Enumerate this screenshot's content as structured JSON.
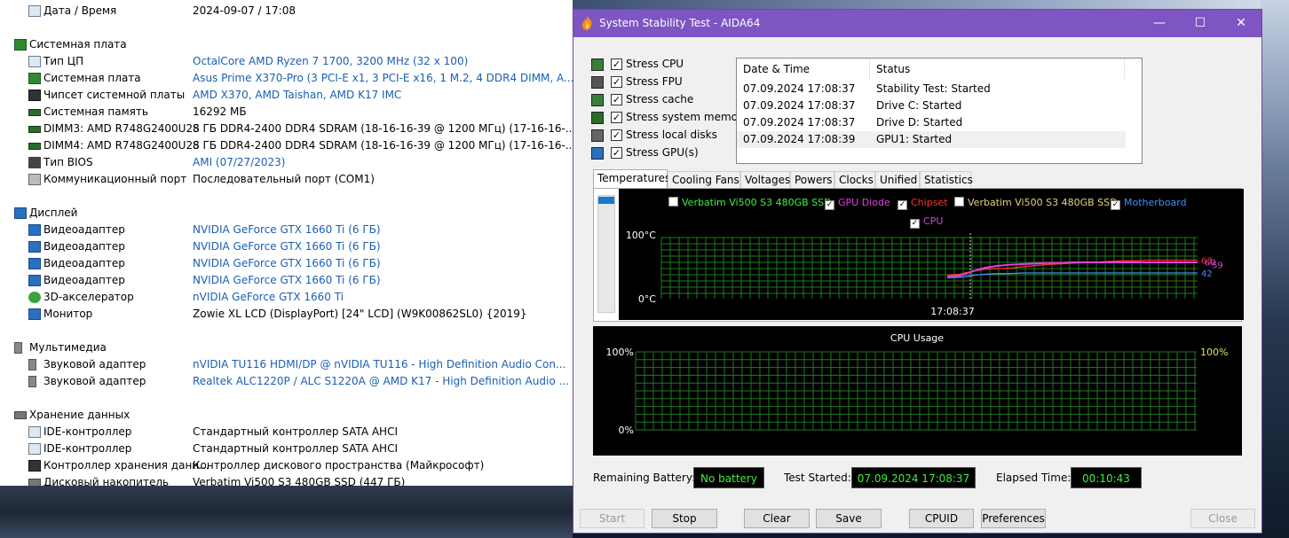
{
  "info": {
    "rows": [
      {
        "type": "item",
        "icon": "calendar-icon",
        "key": "Дата / Время",
        "value": "2024-09-07 / 17:08",
        "link": false
      },
      {
        "type": "blank"
      },
      {
        "type": "section",
        "icon": "motherboard-icon",
        "key": "Системная плата"
      },
      {
        "type": "item",
        "icon": "cpu-icon",
        "key": "Тип ЦП",
        "value": "OctalCore AMD Ryzen 7 1700, 3200 MHz (32 x 100)",
        "link": true
      },
      {
        "type": "item",
        "icon": "motherboard-icon",
        "key": "Системная плата",
        "value": "Asus Prime X370-Pro  (3 PCI-E x1, 3 PCI-E x16, 1 M.2, 4 DDR4 DIMM, A...",
        "link": true
      },
      {
        "type": "item",
        "icon": "chipset-icon",
        "key": "Чипсет системной платы",
        "value": "AMD X370, AMD Taishan, AMD K17 IMC",
        "link": true
      },
      {
        "type": "item",
        "icon": "memory-icon",
        "key": "Системная память",
        "value": "16292 МБ",
        "link": false
      },
      {
        "type": "item",
        "icon": "memory-icon",
        "key": "DIMM3: AMD R748G2400U2S",
        "value": "8 ГБ DDR4-2400 DDR4 SDRAM  (18-16-16-39 @ 1200 МГц)  (17-16-16-...",
        "link": false
      },
      {
        "type": "item",
        "icon": "memory-icon",
        "key": "DIMM4: AMD R748G2400U2S",
        "value": "8 ГБ DDR4-2400 DDR4 SDRAM  (18-16-16-39 @ 1200 МГц)  (17-16-16-...",
        "link": false
      },
      {
        "type": "item",
        "icon": "bios-icon",
        "key": "Тип BIOS",
        "value": "AMI (07/27/2023)",
        "link": true
      },
      {
        "type": "item",
        "icon": "port-icon",
        "key": "Коммуникационный порт",
        "value": "Последовательный порт (COM1)",
        "link": false
      },
      {
        "type": "blank"
      },
      {
        "type": "section",
        "icon": "monitor-icon",
        "key": "Дисплей"
      },
      {
        "type": "item",
        "icon": "gpu-icon",
        "key": "Видеоадаптер",
        "value": "NVIDIA GeForce GTX 1660 Ti  (6 ГБ)",
        "link": true
      },
      {
        "type": "item",
        "icon": "gpu-icon",
        "key": "Видеоадаптер",
        "value": "NVIDIA GeForce GTX 1660 Ti  (6 ГБ)",
        "link": true
      },
      {
        "type": "item",
        "icon": "gpu-icon",
        "key": "Видеоадаптер",
        "value": "NVIDIA GeForce GTX 1660 Ti  (6 ГБ)",
        "link": true
      },
      {
        "type": "item",
        "icon": "gpu-icon",
        "key": "Видеоадаптер",
        "value": "NVIDIA GeForce GTX 1660 Ti  (6 ГБ)",
        "link": true
      },
      {
        "type": "item",
        "icon": "xbox-icon",
        "key": "3D-акселератор",
        "value": "nVIDIA GeForce GTX 1660 Ti",
        "link": true
      },
      {
        "type": "item",
        "icon": "monitor-icon",
        "key": "Монитор",
        "value": "Zowie XL LCD (DisplayPort)  [24\" LCD]  (W9K00862SL0)  {2019}",
        "link": false
      },
      {
        "type": "blank"
      },
      {
        "type": "section",
        "icon": "speaker-icon",
        "key": "Мультимедиа"
      },
      {
        "type": "item",
        "icon": "speaker-icon",
        "key": "Звуковой адаптер",
        "value": "nVIDIA TU116 HDMI/DP @ nVIDIA TU116 - High Definition Audio Con...",
        "link": true
      },
      {
        "type": "item",
        "icon": "speaker-icon",
        "key": "Звуковой адаптер",
        "value": "Realtek ALC1220P / ALC S1220A @ AMD K17 - High Definition Audio ...",
        "link": true
      },
      {
        "type": "blank"
      },
      {
        "type": "section",
        "icon": "disk-icon",
        "key": "Хранение данных"
      },
      {
        "type": "item",
        "icon": "ide-icon",
        "key": "IDE-контроллер",
        "value": "Стандартный контроллер SATA AHCI",
        "link": false
      },
      {
        "type": "item",
        "icon": "ide-icon",
        "key": "IDE-контроллер",
        "value": "Стандартный контроллер SATA AHCI",
        "link": false
      },
      {
        "type": "item",
        "icon": "storage-controller-icon",
        "key": "Контроллер хранения данн...",
        "value": "Контроллер дискового пространства (Майкрософт)",
        "link": false
      },
      {
        "type": "item",
        "icon": "disk-icon",
        "key": "Дисковый накопитель",
        "value": "Verbatim Vi500 S3 480GB SSD  (447 ГБ)",
        "link": false
      }
    ]
  },
  "window": {
    "title": "System Stability Test - AIDA64",
    "minimize": "—",
    "maximize": "☐",
    "close": "✕"
  },
  "stress": [
    {
      "label": "Stress CPU",
      "icon": "cpu-chip-icon",
      "checked": "✓"
    },
    {
      "label": "Stress FPU",
      "icon": "fpu-icon",
      "checked": "✓"
    },
    {
      "label": "Stress cache",
      "icon": "cache-icon",
      "checked": "✓"
    },
    {
      "label": "Stress system memory",
      "icon": "ram-icon",
      "checked": "✓"
    },
    {
      "label": "Stress local disks",
      "icon": "hdd-icon",
      "checked": "✓"
    },
    {
      "label": "Stress GPU(s)",
      "icon": "display-icon",
      "checked": "✓"
    }
  ],
  "log": {
    "col_date": "Date & Time",
    "col_status": "Status",
    "rows": [
      {
        "date": "07.09.2024 17:08:37",
        "status": "Stability Test: Started"
      },
      {
        "date": "07.09.2024 17:08:37",
        "status": "Drive C: Started"
      },
      {
        "date": "07.09.2024 17:08:37",
        "status": "Drive D: Started"
      },
      {
        "date": "07.09.2024 17:08:39",
        "status": "GPU1: Started"
      }
    ]
  },
  "tabs": [
    "Temperatures",
    "Cooling Fans",
    "Voltages",
    "Powers",
    "Clocks",
    "Unified",
    "Statistics"
  ],
  "active_tab": "Temperatures",
  "temp_legend": [
    {
      "label": "Verbatim Vi500 S3 480GB SSD",
      "checked": "",
      "color": "#3ef03e"
    },
    {
      "label": "GPU Diode",
      "checked": "✓",
      "color": "#e040e0"
    },
    {
      "label": "Chipset",
      "checked": "✓",
      "color": "#ff3030"
    },
    {
      "label": "Verbatim Vi500 S3 480GB SSD",
      "checked": "",
      "color": "#e8d080"
    },
    {
      "label": "Motherboard",
      "checked": "✓",
      "color": "#4090ff"
    },
    {
      "label": "CPU",
      "checked": "✓",
      "color": "#e040e0"
    }
  ],
  "chart_data": [
    {
      "type": "line",
      "title": "",
      "ymax_label": "100°C",
      "ymin_label": "0°C",
      "ylim": [
        0,
        100
      ],
      "x_tick": "17:08:37",
      "grid": true,
      "series": [
        {
          "name": "Chipset",
          "color": "#ff3030",
          "end_label": "63",
          "values": [
            39,
            40,
            45,
            48,
            49,
            50,
            52,
            54,
            56,
            57,
            58,
            59,
            60,
            61,
            62,
            62,
            63,
            63,
            63,
            63,
            63
          ]
        },
        {
          "name": "GPU Diode",
          "color": "#e040e0",
          "end_label": "59",
          "values": [
            37,
            38,
            44,
            50,
            53,
            55,
            56,
            57,
            58,
            58,
            59,
            59,
            59,
            59,
            59,
            59,
            59,
            59,
            59,
            59,
            59
          ]
        },
        {
          "name": "CPU",
          "color": "#e040e0",
          "end_label": "60",
          "values": [
            36,
            37,
            45,
            51,
            54,
            56,
            57,
            58,
            59,
            59,
            60,
            60,
            60,
            60,
            60,
            60,
            60,
            60,
            60,
            60,
            60
          ]
        },
        {
          "name": "Motherboard",
          "color": "#4090ff",
          "end_label": "42",
          "values": [
            34,
            35,
            38,
            40,
            41,
            41,
            42,
            42,
            42,
            42,
            42,
            42,
            42,
            42,
            42,
            42,
            42,
            42,
            42,
            42,
            42
          ]
        }
      ]
    },
    {
      "type": "line",
      "title": "CPU Usage",
      "ymax_label": "100%",
      "ymin_label": "0%",
      "right_label": "100%",
      "ylim": [
        0,
        100
      ],
      "grid": true,
      "series": []
    }
  ],
  "status": {
    "battery_label": "Remaining Battery:",
    "battery_value": "No battery",
    "started_label": "Test Started:",
    "started_value": "07.09.2024 17:08:37",
    "elapsed_label": "Elapsed Time:",
    "elapsed_value": "00:10:43"
  },
  "buttons": {
    "start": "Start",
    "stop": "Stop",
    "clear": "Clear",
    "save": "Save",
    "cpuid": "CPUID",
    "preferences": "Preferences",
    "close": "Close"
  }
}
